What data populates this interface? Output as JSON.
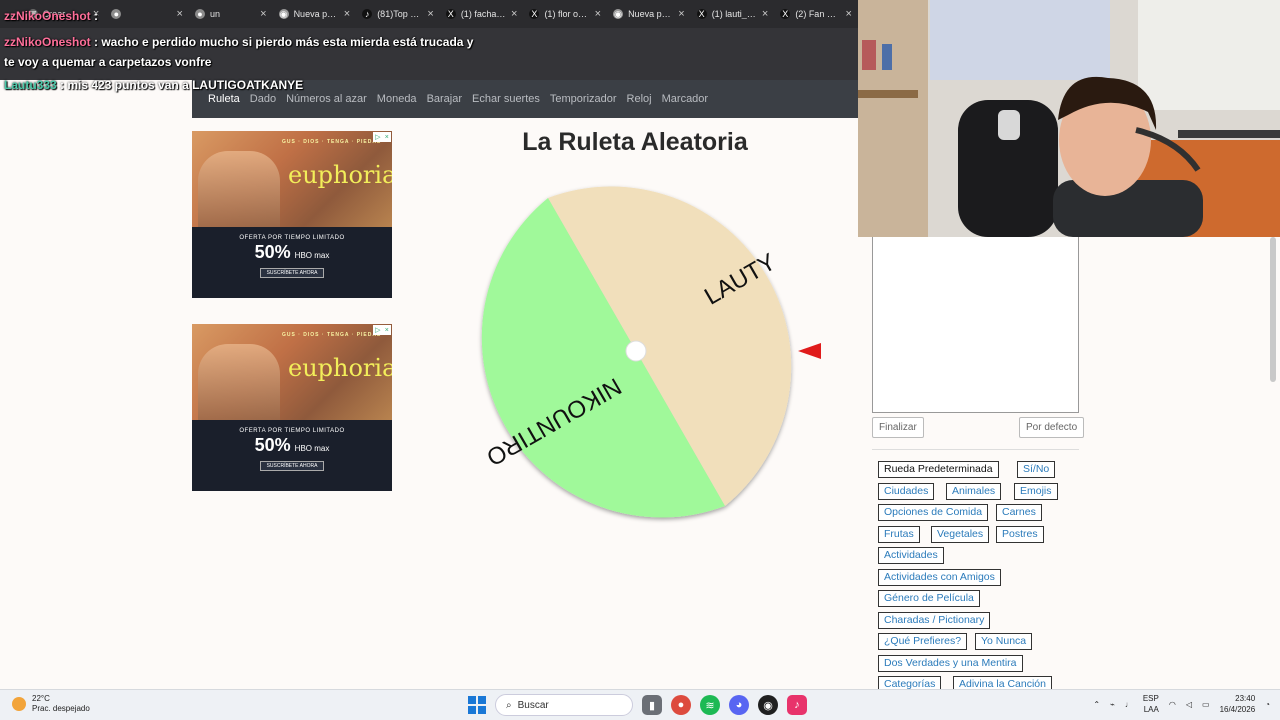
{
  "browser": {
    "tabs": [
      {
        "label": "Crear",
        "icon": "generic-icon",
        "color": "#6b6b6b"
      },
      {
        "label": "",
        "icon": "avatar-icon",
        "color": "#8c8c8c"
      },
      {
        "label": "un",
        "icon": "avatar-icon",
        "color": "#8c8c8c"
      },
      {
        "label": "Nueva pesta",
        "icon": "chrome-icon",
        "color": "#9a9a9a"
      },
      {
        "label": "(81)Top 100",
        "icon": "tiktok-icon",
        "color": "#111111"
      },
      {
        "label": "(1) facha en",
        "icon": "x-icon",
        "color": "#111111"
      },
      {
        "label": "(1) flor on X",
        "icon": "x-icon",
        "color": "#111111"
      },
      {
        "label": "Nueva pesta",
        "icon": "chrome-icon",
        "color": "#9a9a9a"
      },
      {
        "label": "(1) lauti_VN",
        "icon": "x-icon",
        "color": "#111111"
      },
      {
        "label": "(2) Fan Spot",
        "icon": "x-icon",
        "color": "#111111"
      }
    ],
    "close_glyph": "×",
    "window_close_glyph": "✕"
  },
  "chat": [
    {
      "user": "zzNikoOneshot",
      "sep": " :",
      "text": ""
    },
    {
      "user": "zzNikoOneshot",
      "sep": " :",
      "text": " wacho e perdido mucho si pierdo más esta mierda está trucada y"
    },
    {
      "user": "",
      "sep": "",
      "text": "te voy a quemar a carpetazos vonfre"
    },
    {
      "user": "Lautu333",
      "sep": " :",
      "text": " mis 423 puntos van a LAUTIGOATKANYE"
    }
  ],
  "nav": {
    "items": [
      "Ruleta",
      "Dado",
      "Números al azar",
      "Moneda",
      "Barajar",
      "Echar suertes",
      "Temporizador",
      "Reloj",
      "Marcador"
    ],
    "active": "Ruleta"
  },
  "ads": [
    {
      "cast": "GUS · DIOS · TENGA · PIEDAD",
      "logo": "euphoria",
      "offer": "OFERTA POR TIEMPO LIMITADO",
      "percent": "50%",
      "brand": "HBO max",
      "cta": "SUSCRÍBETE AHORA"
    },
    {
      "cast": "GUS · DIOS · TENGA · PIEDAD",
      "logo": "euphoria",
      "offer": "OFERTA POR TIEMPO LIMITADO",
      "percent": "50%",
      "brand": "HBO max",
      "cta": "SUSCRÍBETE AHORA"
    }
  ],
  "roulette": {
    "title": "La Ruleta Aleatoria",
    "segments": [
      {
        "label": "LAUTY",
        "color": "#f1dfbb"
      },
      {
        "label": "NIKOUNTIRO",
        "color": "#a0f99a"
      }
    ],
    "pointer_color": "#e01b1b"
  },
  "panel": {
    "finish_button": "Finalizar",
    "default_button": "Por defecto",
    "categories": [
      "Rueda Predeterminada",
      "Sí/No",
      "Ciudades",
      "Animales",
      "Emojis",
      "Opciones de Comida",
      "Carnes",
      "Frutas",
      "Vegetales",
      "Postres",
      "Actividades",
      "Actividades con Amigos",
      "Género de Película",
      "Charadas / Pictionary",
      "¿Qué Prefieres?",
      "Yo Nunca",
      "Dos Verdades y una Mentira",
      "Categorías",
      "Adivina la Canción"
    ],
    "active_category": "Rueda Predeterminada"
  },
  "taskbar": {
    "temperature": "22°C",
    "weather": "Prac. despejado",
    "search_placeholder": "Buscar",
    "lang_top": "ESP",
    "lang_bottom": "LAA",
    "time": "23:40",
    "date": "16/4/2026"
  }
}
